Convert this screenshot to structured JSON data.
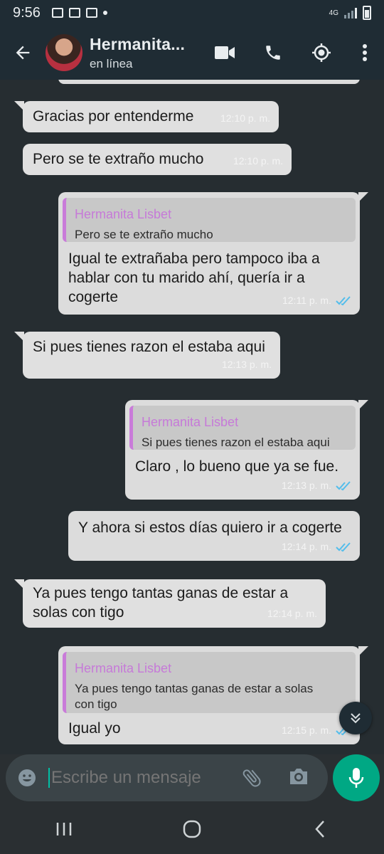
{
  "status_bar": {
    "time": "9:56",
    "network": "4G",
    "colors": {
      "bg": "#1f2c34"
    }
  },
  "header": {
    "contact_name": "Hermanita...",
    "contact_status": "en línea",
    "icons": [
      "back-arrow-icon",
      "avatar",
      "video-call-icon",
      "phone-icon",
      "location-icon",
      "more-options-icon"
    ]
  },
  "messages": [
    {
      "direction": "in",
      "text": "Gracias por entenderme",
      "time": "12:10 p. m."
    },
    {
      "direction": "in",
      "text": "Pero se te extraño mucho",
      "time": "12:10 p. m."
    },
    {
      "direction": "out",
      "quote": {
        "name": "Hermanita Lisbet",
        "text": "Pero se te extraño mucho"
      },
      "lines": [
        "Igual te extrañaba pero tampoco iba a",
        "hablar con tu marido ahí,  quería ir a",
        "cogerte"
      ],
      "time": "12:11 p. m."
    },
    {
      "direction": "in",
      "text": "Si pues tienes razon el estaba aqui",
      "time": "12:13 p. m."
    },
    {
      "direction": "out",
      "quote": {
        "name": "Hermanita Lisbet",
        "text": "Si pues tienes razon el estaba aqui"
      },
      "text": "Claro , lo bueno que ya se fue.",
      "time": "12:13 p. m."
    },
    {
      "direction": "out",
      "text": "Y ahora si estos días quiero ir a cogerte",
      "time": "12:14 p. m."
    },
    {
      "direction": "in",
      "lines": [
        "Ya pues tengo tantas ganas de estar a",
        "solas con tigo"
      ],
      "time": "12:14 p. m."
    },
    {
      "direction": "out",
      "quote": {
        "name": "Hermanita Lisbet",
        "lines": [
          "Ya pues tengo tantas ganas de estar a solas",
          "con tigo"
        ]
      },
      "text": "Igual yo",
      "time": "12:15 p. m."
    }
  ],
  "composer": {
    "placeholder": "Escribe un mensaje"
  },
  "colors": {
    "accent": "#00a884",
    "quote_name": "#c67ad8",
    "read_ticks": "#53bdeb",
    "bubble": "#dcdcdc"
  }
}
